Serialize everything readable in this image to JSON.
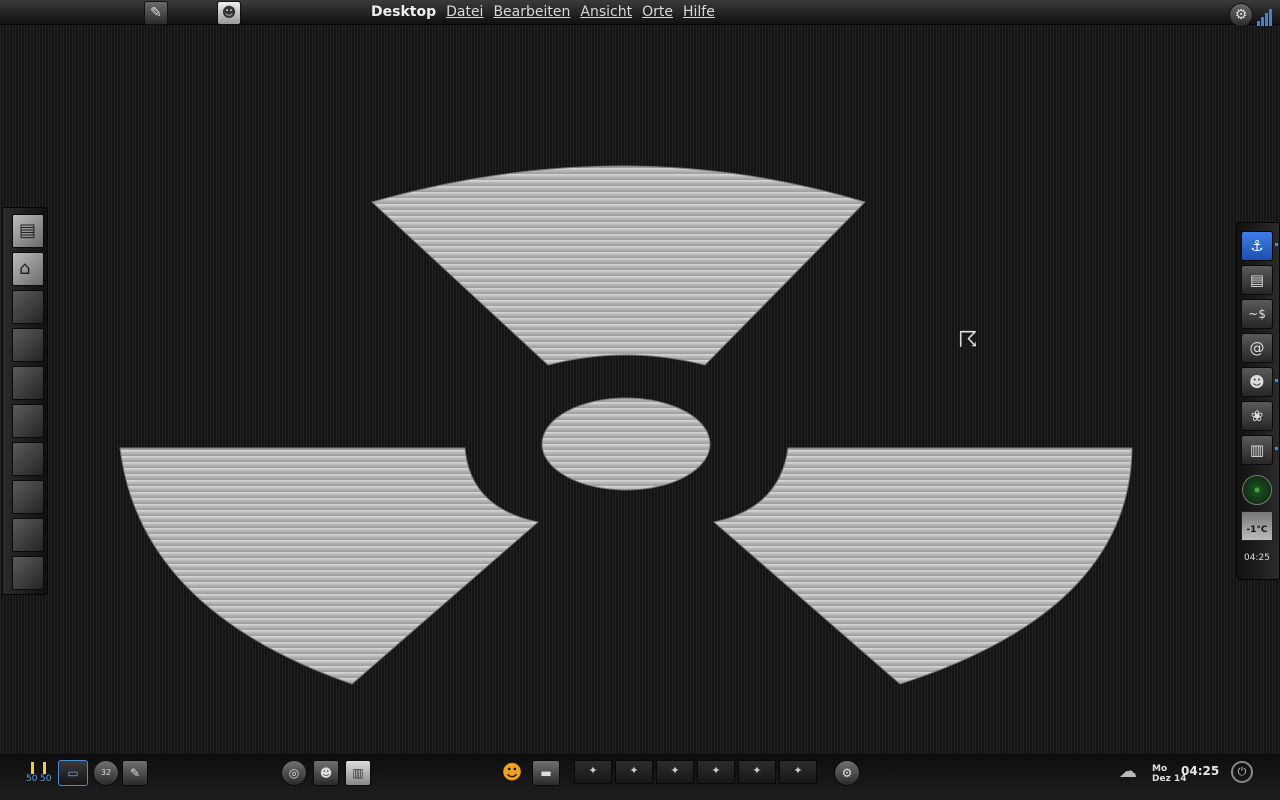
{
  "top_panel": {
    "menu": [
      "Desktop",
      "Datei",
      "Bearbeiten",
      "Ansicht",
      "Orte",
      "Hilfe"
    ],
    "menu_mnemonics": [
      "",
      "D",
      "B",
      "A",
      "O",
      "H"
    ],
    "launchers": [
      "gimp-icon",
      "gnome-foot-icon"
    ]
  },
  "left_dock": {
    "items": [
      "file-manager-icon",
      "home-icon",
      "folder-icon",
      "folder-icon",
      "folder-icon",
      "folder-icon",
      "folder-icon",
      "folder-icon",
      "folder-icon",
      "folder-icon"
    ]
  },
  "right_dock": {
    "items": [
      {
        "icon": "anchor-icon",
        "glyph": "⚓"
      },
      {
        "icon": "hard-drive-icon",
        "glyph": "▤"
      },
      {
        "icon": "terminal-icon",
        "glyph": "~$"
      },
      {
        "icon": "email-icon",
        "glyph": "@"
      },
      {
        "icon": "pidgin-icon",
        "glyph": "☻"
      },
      {
        "icon": "gimp-icon",
        "glyph": "❀"
      },
      {
        "icon": "file-cabinet-icon",
        "glyph": "▥"
      }
    ],
    "weather_temp": "-1°C",
    "clock": "04:25"
  },
  "bottom_panel": {
    "cpu_values": [
      "50",
      "50"
    ],
    "tray_left": [
      "monitor-icon",
      "thermo-icon",
      "gimp-icon"
    ],
    "launchers": [
      "firefox-icon",
      "pidgin-icon",
      "file-cabinet-icon"
    ],
    "gnome_foot": "gnome-foot-icon",
    "workspaces": [
      "1",
      "2",
      "3",
      "4",
      "5",
      "6"
    ],
    "workspace_glyph": "✦",
    "weather_icon": "cloud-icon",
    "date_day": "Mo",
    "date_date": "Dez 14",
    "time": "04:25"
  }
}
